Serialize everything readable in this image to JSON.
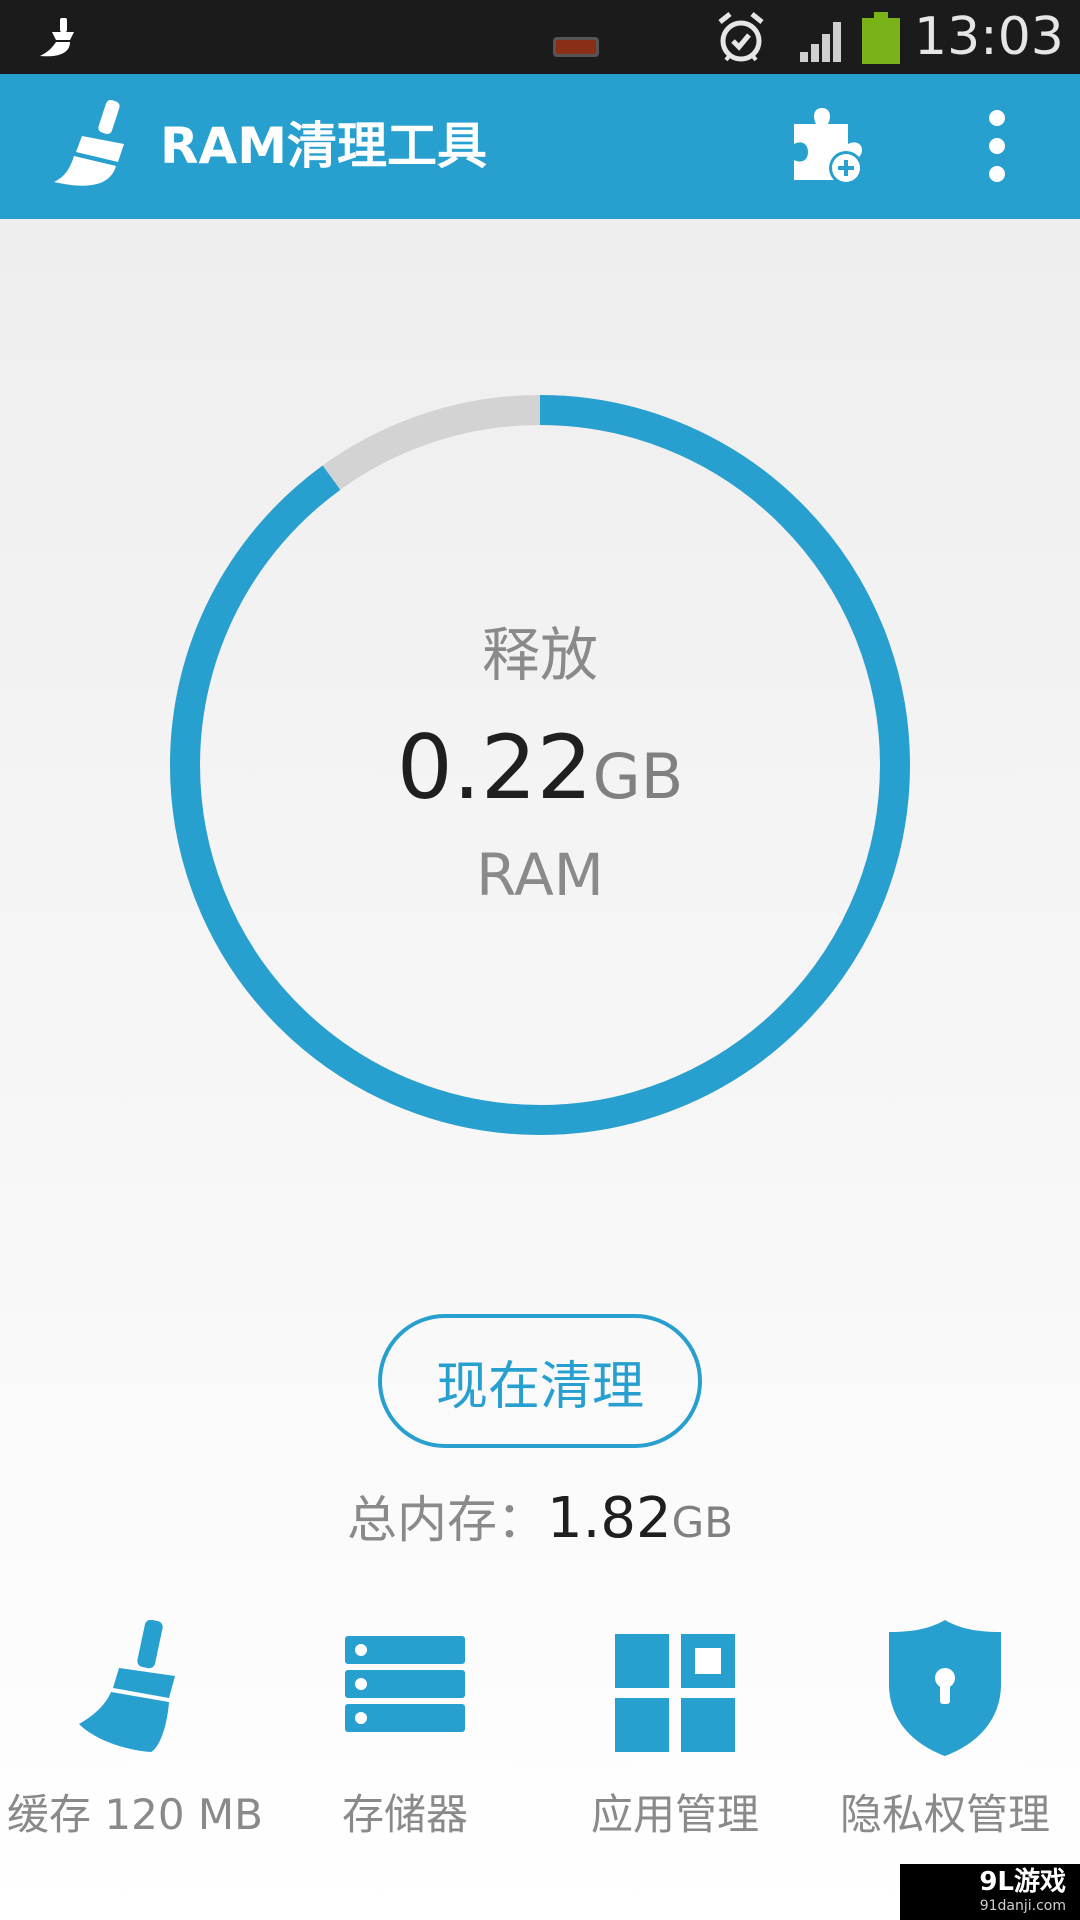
{
  "status_bar": {
    "time": "13:03",
    "icons": [
      "cleaner-notification-icon",
      "notification-icon",
      "alarm-icon",
      "signal-icon",
      "battery-icon"
    ],
    "battery_color": "#7ab317"
  },
  "app_bar": {
    "title": "RAM清理工具",
    "color": "#279fcf",
    "icons": [
      "broom-logo-icon",
      "plugin-add-icon",
      "overflow-menu-icon"
    ]
  },
  "gauge": {
    "free_label": "释放",
    "value": "0.22",
    "unit": "GB",
    "resource": "RAM",
    "used_fraction": 0.9,
    "arc_color": "#279fcf",
    "track_color": "#d3d3d3"
  },
  "clean_button": {
    "label": "现在清理"
  },
  "total": {
    "label": "总内存：",
    "value": "1.82",
    "unit": "GB"
  },
  "tools": [
    {
      "label": "缓存 120 MB",
      "icon": "broom-icon"
    },
    {
      "label": "存储器",
      "icon": "storage-icon"
    },
    {
      "label": "应用管理",
      "icon": "app-grid-icon"
    },
    {
      "label": "隐私权管理",
      "icon": "shield-lock-icon"
    }
  ],
  "watermark": {
    "main": "9L游戏",
    "sub": "91danji.com"
  }
}
